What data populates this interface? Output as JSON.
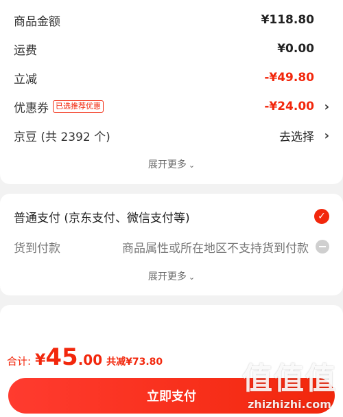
{
  "summary": {
    "rows": [
      {
        "label": "商品金额",
        "value": "¥118.80"
      },
      {
        "label": "运费",
        "value": "¥0.00"
      },
      {
        "label": "立减",
        "value": "-¥49.80"
      },
      {
        "label": "优惠券",
        "tag": "已选推荐优惠",
        "value": "-¥24.00"
      },
      {
        "label": "京豆 (共 2392 个)",
        "value": "去选择"
      }
    ],
    "expand_label": "展开更多"
  },
  "payment": {
    "normal_label": "普通支付 (京东支付、微信支付等)",
    "cod_label": "货到付款",
    "cod_note": "商品属性或所在地区不支持货到付款",
    "expand_label": "展开更多"
  },
  "bottom": {
    "total_label": "合计:",
    "currency": "¥",
    "amount_int": "45",
    "amount_dec": ".00",
    "saving": "共减¥73.80",
    "pay_label": "立即支付"
  },
  "watermark": {
    "chars": "值值值",
    "url": "zhizhizhi.com"
  },
  "colors": {
    "accent": "#f2270c",
    "background": "#f2f2f2"
  }
}
